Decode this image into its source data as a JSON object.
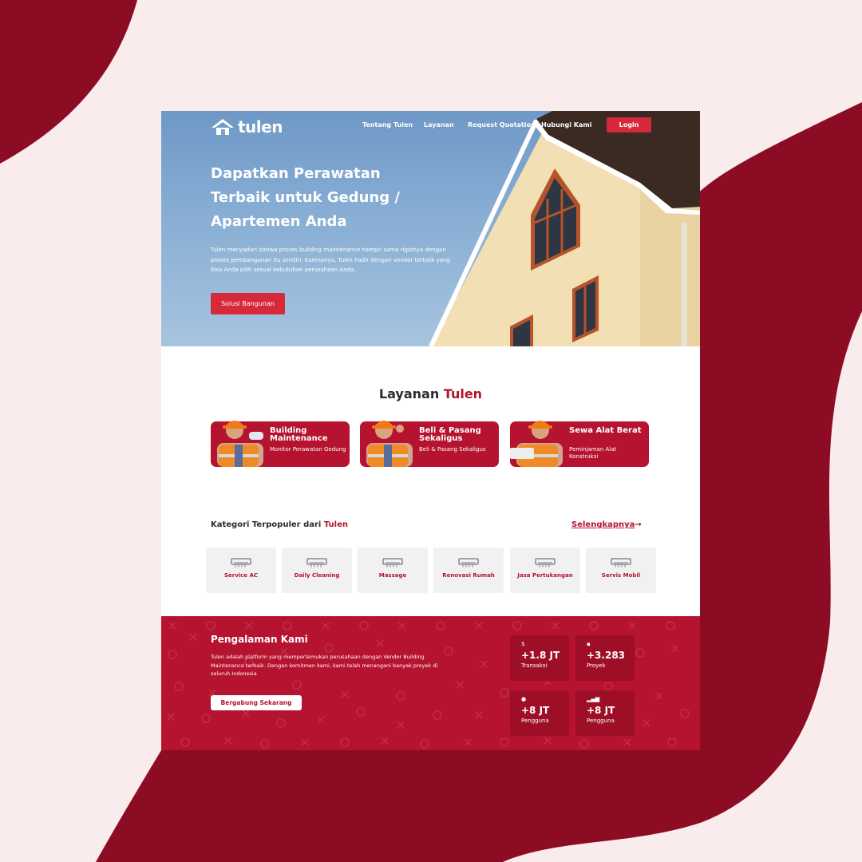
{
  "colors": {
    "brand_red": "#b5132f",
    "button_red": "#d62a3c",
    "dark_maroon": "#8c0c24",
    "page_bg": "#faecec"
  },
  "nav": {
    "logo_text": "tulen",
    "logo_icon": "house-icon",
    "links": [
      "Tentang Tulen",
      "Layanan",
      "Request Quotation",
      "Hubungi Kami"
    ],
    "login": "Login"
  },
  "hero": {
    "title": "Dapatkan Perawatan Terbaik untuk Gedung / Apartemen Anda",
    "description": "Tulen menyadari bahwa proses building maintenance hampir sama rigidnya dengan proses pembangunan itu sendiri. Karenanya, Tulen hadir dengan vendor terbaik yang bisa Anda pilih sesuai kebutuhan perusahaan Anda.",
    "button": "Solusi Bangunan"
  },
  "layanan": {
    "title_prefix": "Layanan",
    "title_accent": "Tulen",
    "cards": [
      {
        "title": "Building Maintenance",
        "subtitle": "Monitor Perawatan Gedung"
      },
      {
        "title": "Beli & Pasang Sekaligus",
        "subtitle": "Beli & Pasang Sekaligus"
      },
      {
        "title": "Sewa Alat Berat",
        "subtitle": "Peminjaman Alat Konstruksi"
      }
    ]
  },
  "kategori": {
    "title_prefix": "Kategori Terpopuler dari",
    "title_accent": "Tulen",
    "more_link": "Selengkapnya",
    "more_arrow": "→",
    "items": [
      "Service AC",
      "Daily Cleaning",
      "Massage",
      "Renovasi Rumah",
      "Jasa Pertukangan",
      "Servis Mobil"
    ],
    "item_icon": "air-conditioner-icon"
  },
  "pengalaman": {
    "title": "Pengalaman Kami",
    "description": "Tulen adalah platform yang mempertemukan perusahaan dengan Vendor Building Maintenance terbaik. Dengan komitmen kami, kami telah menangani banyak proyek di seluruh Indonesia",
    "button": "Bergabung Sekarang",
    "stats": [
      {
        "icon": "money-icon",
        "glyph": "$",
        "value": "+1.8 JT",
        "label": "Transaksi"
      },
      {
        "icon": "briefcase-icon",
        "glyph": "▪",
        "value": "+3.283",
        "label": "Proyek"
      },
      {
        "icon": "user-icon",
        "glyph": "●",
        "value": "+8 JT",
        "label": "Pengguna"
      },
      {
        "icon": "signal-icon",
        "glyph": "▂▄▆",
        "value": "+8 JT",
        "label": "Pengguna"
      }
    ]
  }
}
